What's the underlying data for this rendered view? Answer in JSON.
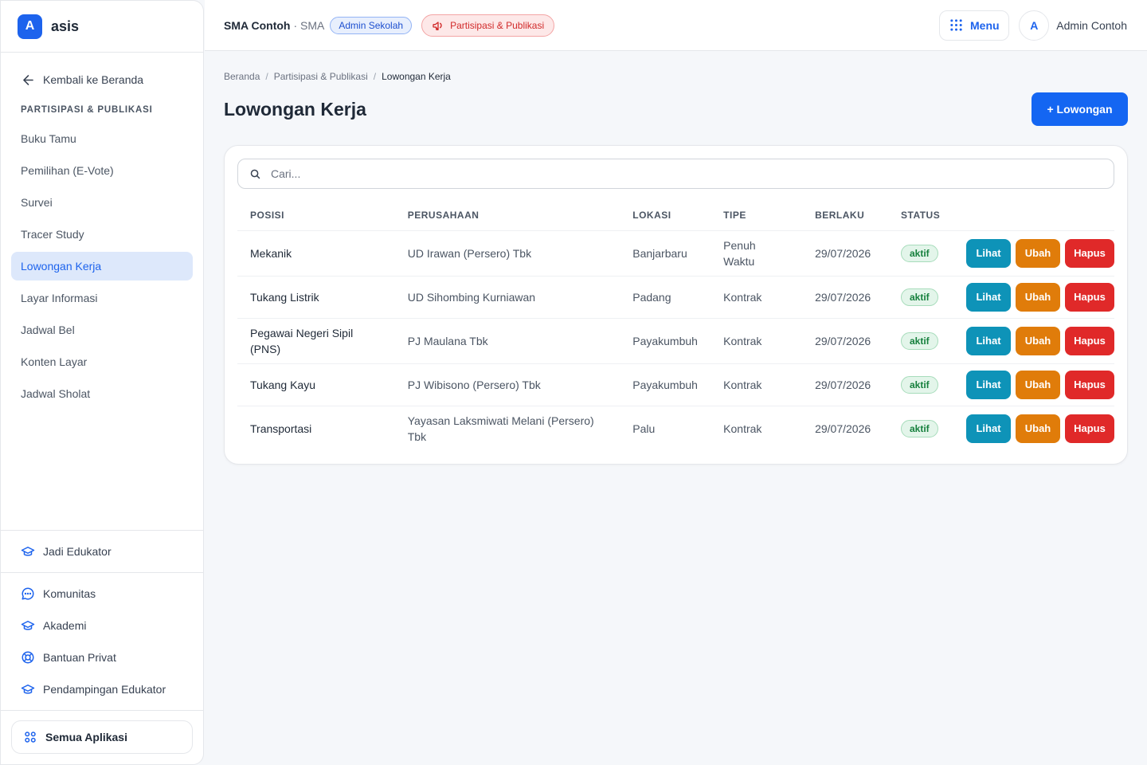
{
  "brand": {
    "logo_letter": "A",
    "name": "asis"
  },
  "sidebar": {
    "back_label": "Kembali ke Beranda",
    "section_title": "PARTISIPASI & PUBLIKASI",
    "items": [
      {
        "label": "Buku Tamu"
      },
      {
        "label": "Pemilihan (E-Vote)"
      },
      {
        "label": "Survei"
      },
      {
        "label": "Tracer Study"
      },
      {
        "label": "Lowongan Kerja",
        "active": true
      },
      {
        "label": "Layar Informasi"
      },
      {
        "label": "Jadwal Bel"
      },
      {
        "label": "Konten Layar"
      },
      {
        "label": "Jadwal Sholat"
      }
    ],
    "educator_label": "Jadi Edukator",
    "bottom_items": [
      {
        "label": "Komunitas",
        "icon": "chat-icon"
      },
      {
        "label": "Akademi",
        "icon": "graduation-cap-icon"
      },
      {
        "label": "Bantuan Privat",
        "icon": "lifebuoy-icon"
      },
      {
        "label": "Pendampingan Edukator",
        "icon": "graduation-cap-icon"
      }
    ],
    "all_apps_label": "Semua Aplikasi"
  },
  "topbar": {
    "school_name": "SMA Contoh",
    "school_sub": "· SMA",
    "role_badge": "Admin Sekolah",
    "module_badge": "Partisipasi & Publikasi",
    "menu_label": "Menu",
    "avatar_letter": "A",
    "user_name": "Admin Contoh"
  },
  "breadcrumb": [
    "Beranda",
    "Partisipasi & Publikasi",
    "Lowongan Kerja"
  ],
  "page": {
    "title": "Lowongan Kerja",
    "add_button": "+ Lowongan"
  },
  "search": {
    "placeholder": "Cari...",
    "value": ""
  },
  "table": {
    "headers": [
      "POSISI",
      "PERUSAHAAN",
      "LOKASI",
      "TIPE",
      "BERLAKU",
      "STATUS"
    ],
    "rows": [
      {
        "posisi": "Mekanik",
        "perusahaan": "UD Irawan (Persero) Tbk",
        "lokasi": "Banjarbaru",
        "tipe": "Penuh Waktu",
        "berlaku": "29/07/2026",
        "status": "aktif"
      },
      {
        "posisi": "Tukang Listrik",
        "perusahaan": "UD Sihombing Kurniawan",
        "lokasi": "Padang",
        "tipe": "Kontrak",
        "berlaku": "29/07/2026",
        "status": "aktif"
      },
      {
        "posisi": "Pegawai Negeri Sipil (PNS)",
        "perusahaan": "PJ Maulana Tbk",
        "lokasi": "Payakumbuh",
        "tipe": "Kontrak",
        "berlaku": "29/07/2026",
        "status": "aktif"
      },
      {
        "posisi": "Tukang Kayu",
        "perusahaan": "PJ Wibisono (Persero) Tbk",
        "lokasi": "Payakumbuh",
        "tipe": "Kontrak",
        "berlaku": "29/07/2026",
        "status": "aktif"
      },
      {
        "posisi": "Transportasi",
        "perusahaan": "Yayasan Laksmiwati Melani (Persero) Tbk",
        "lokasi": "Palu",
        "tipe": "Kontrak",
        "berlaku": "29/07/2026",
        "status": "aktif"
      }
    ],
    "actions": {
      "view": "Lihat",
      "edit": "Ubah",
      "delete": "Hapus"
    }
  },
  "colors": {
    "primary": "#1466f2",
    "view": "#0e93b8",
    "edit": "#e07c0a",
    "delete": "#e02929",
    "status_active": "#16803d"
  }
}
